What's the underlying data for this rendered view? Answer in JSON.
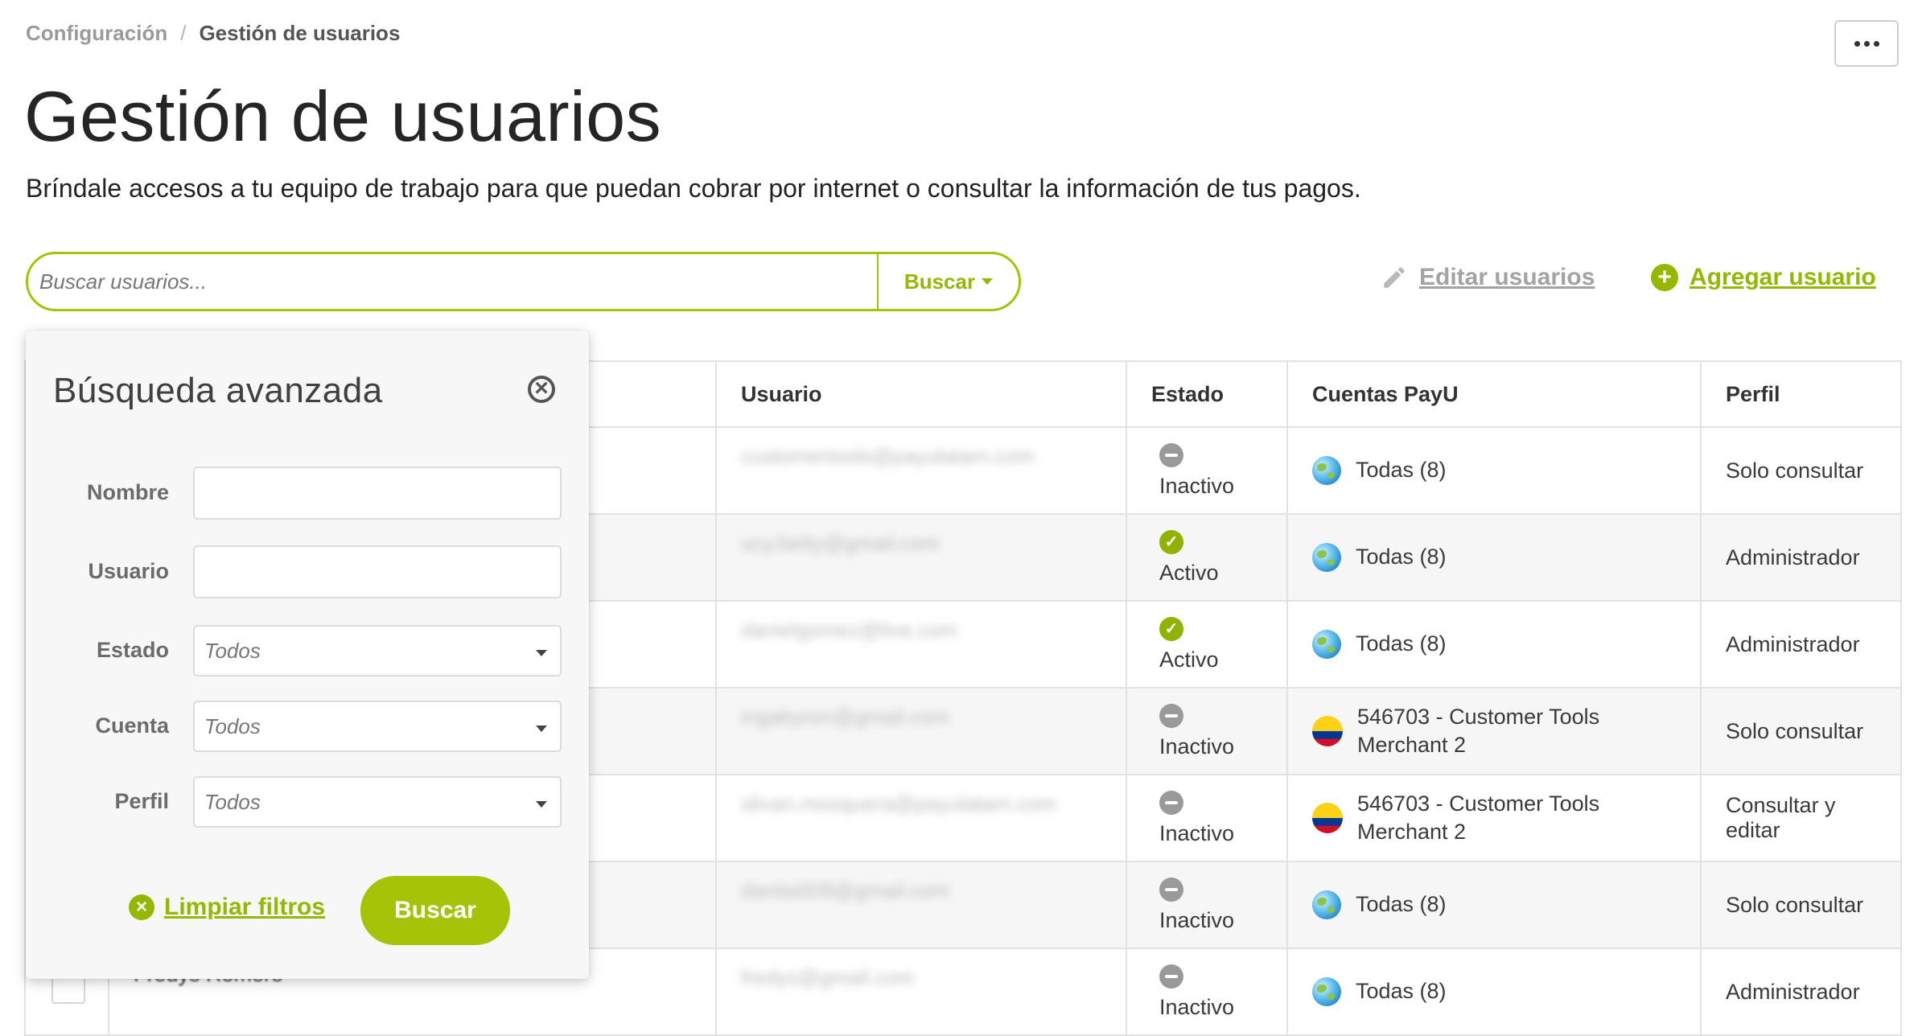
{
  "breadcrumb": {
    "parent": "Configuración",
    "separator": "/",
    "current": "Gestión de usuarios"
  },
  "header": {
    "title": "Gestión de usuarios",
    "description": "Bríndale accesos a tu equipo de trabajo para que puedan cobrar por internet o consultar la información de tus pagos."
  },
  "search": {
    "placeholder": "Buscar usuarios...",
    "button_label": "Buscar"
  },
  "actions": {
    "edit_users": "Editar usuarios",
    "add_user": "Agregar usuario"
  },
  "table": {
    "headers": {
      "usuario": "Usuario",
      "estado": "Estado",
      "cuentas": "Cuentas PayU",
      "perfil": "Perfil"
    },
    "rows": [
      {
        "email": "customertools@payulatam.com",
        "status": "Inactivo",
        "account": "Todas (8)",
        "profile": "Solo consultar"
      },
      {
        "email": "ucy.betty@gmail.com",
        "status": "Activo",
        "account": "Todas (8)",
        "profile": "Administrador"
      },
      {
        "email": "danielgomez@live.com",
        "status": "Activo",
        "account": "Todas (8)",
        "profile": "Administrador"
      },
      {
        "email": "ingabyron@gmail.com",
        "status": "Inactivo",
        "account": "546703 - Customer Tools Merchant 2",
        "profile": "Solo consultar"
      },
      {
        "email": "slivan.mosquera@payulatam.com",
        "status": "Inactivo",
        "account": "546703 - Customer Tools Merchant 2",
        "profile": "Consultar y editar"
      },
      {
        "email": "danita009@gmail.com",
        "status": "Inactivo",
        "account": "Todas (8)",
        "profile": "Solo consultar"
      },
      {
        "email": "fredys@gmail.com",
        "status": "Inactivo",
        "account": "Todas (8)",
        "profile": "Administrador",
        "name": "Fredys Romero"
      }
    ]
  },
  "advanced_search": {
    "title": "Búsqueda avanzada",
    "fields": {
      "nombre": "Nombre",
      "usuario": "Usuario",
      "estado": "Estado",
      "cuenta": "Cuenta",
      "perfil": "Perfil"
    },
    "select_default": "Todos",
    "clear_label": "Limpiar filtros",
    "search_label": "Buscar"
  },
  "colors": {
    "accent": "#a6c307",
    "accent_text": "#94b800",
    "active_status": "#8fb300",
    "inactive_status": "#9a9a9a"
  }
}
